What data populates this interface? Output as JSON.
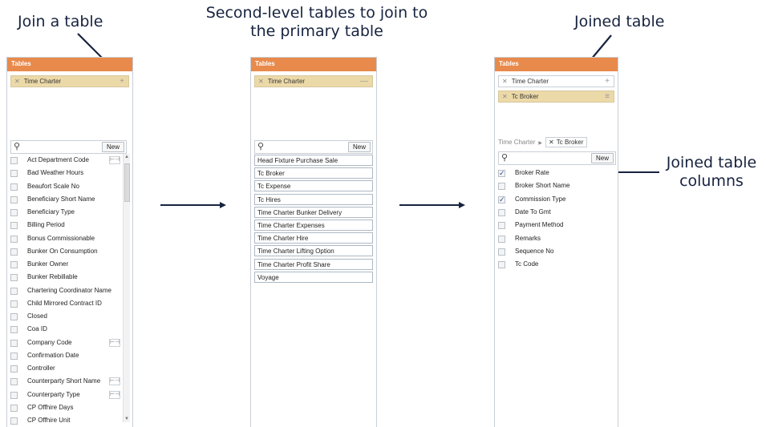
{
  "captions": {
    "join_a_table": "Join a table",
    "second_level": "Second-level tables to join to the primary table",
    "joined_table": "Joined table",
    "joined_columns": "Joined table columns"
  },
  "panel1": {
    "header": "Tables",
    "chip_label": "Time Charter",
    "chip_action_icon": "plus-icon",
    "new_button": "New",
    "rows": [
      {
        "label": "Act Department Code",
        "join": true
      },
      {
        "label": "Bad Weather Hours",
        "join": false
      },
      {
        "label": "Beaufort Scale No",
        "join": false
      },
      {
        "label": "Beneficiary Short Name",
        "join": false
      },
      {
        "label": "Beneficiary Type",
        "join": false
      },
      {
        "label": "Billing Period",
        "join": false
      },
      {
        "label": "Bonus Commissionable",
        "join": false
      },
      {
        "label": "Bunker On Consumption",
        "join": false
      },
      {
        "label": "Bunker Owner",
        "join": false
      },
      {
        "label": "Bunker Rebillable",
        "join": false
      },
      {
        "label": "Chartering Coordinator Name",
        "join": false
      },
      {
        "label": "Child Mirrored Contract ID",
        "join": false
      },
      {
        "label": "Closed",
        "join": false
      },
      {
        "label": "Coa ID",
        "join": false
      },
      {
        "label": "Company Code",
        "join": true
      },
      {
        "label": "Confirmation Date",
        "join": false
      },
      {
        "label": "Controller",
        "join": false
      },
      {
        "label": "Counterparty Short Name",
        "join": true
      },
      {
        "label": "Counterparty Type",
        "join": true
      },
      {
        "label": "CP Offhire Days",
        "join": false
      },
      {
        "label": "CP Offhire Unit",
        "join": false
      }
    ]
  },
  "panel2": {
    "header": "Tables",
    "chip_label": "Time Charter",
    "chip_action_icon": "minus-icon",
    "new_button": "New",
    "tables": [
      "Head Fixture Purchase Sale",
      "Tc Broker",
      "Tc Expense",
      "Tc Hires",
      "Time Charter Bunker Delivery",
      "Time Charter Expenses",
      "Time Charter Hire",
      "Time Charter Lifting Option",
      "Time Charter Profit Share",
      "Voyage"
    ]
  },
  "panel3": {
    "header": "Tables",
    "chip1_label": "Time Charter",
    "chip2_label": "Tc Broker",
    "crumb_root": "Time Charter",
    "crumb_current": "Tc Broker",
    "new_button": "New",
    "rows": [
      {
        "label": "Broker Rate",
        "checked": true
      },
      {
        "label": "Broker Short Name",
        "checked": false
      },
      {
        "label": "Commission Type",
        "checked": true
      },
      {
        "label": "Date To Gmt",
        "checked": false
      },
      {
        "label": "Payment Method",
        "checked": false
      },
      {
        "label": "Remarks",
        "checked": false
      },
      {
        "label": "Sequence No",
        "checked": false
      },
      {
        "label": "Tc Code",
        "checked": false
      }
    ]
  },
  "colors": {
    "header_orange": "#e88a4c",
    "chip_tan": "#ecd9a8",
    "arrow_navy": "#17233f"
  }
}
